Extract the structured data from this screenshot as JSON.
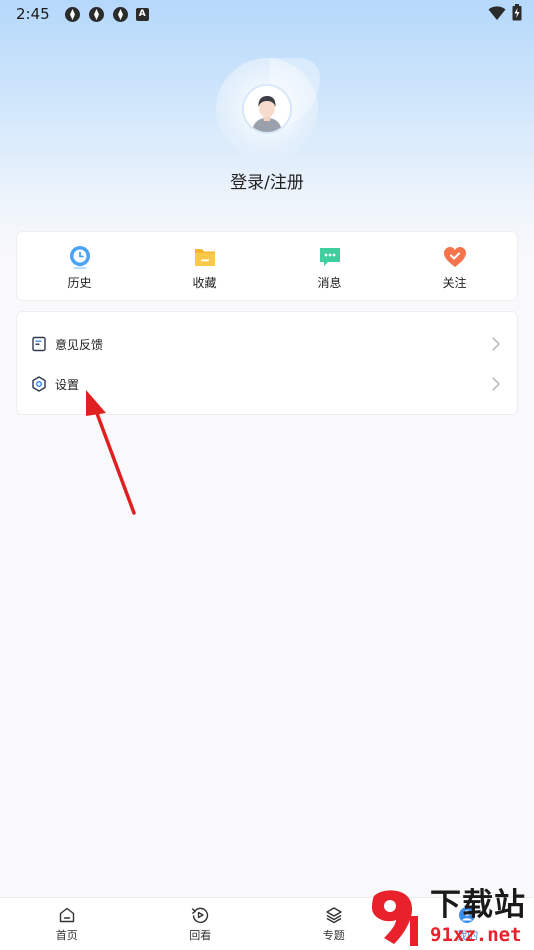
{
  "status_bar": {
    "time": "2:45",
    "notification_badge": "A"
  },
  "profile": {
    "login_label": "登录/注册"
  },
  "quick_actions": [
    {
      "label": "历史",
      "icon": "history-clock-icon",
      "color": "#4aa3f5"
    },
    {
      "label": "收藏",
      "icon": "favorite-folder-icon",
      "color": "#f8b52c"
    },
    {
      "label": "消息",
      "icon": "message-bubble-icon",
      "color": "#3fcf9e"
    },
    {
      "label": "关注",
      "icon": "follow-heart-icon",
      "color": "#f5734d"
    }
  ],
  "menu": [
    {
      "label": "意见反馈",
      "icon": "feedback-doc-icon"
    },
    {
      "label": "设置",
      "icon": "settings-gear-icon"
    }
  ],
  "tabbar": [
    {
      "label": "首页",
      "icon": "home-icon"
    },
    {
      "label": "回看",
      "icon": "replay-icon"
    },
    {
      "label": "专题",
      "icon": "layers-icon"
    },
    {
      "label": "我的",
      "icon": "profile-icon"
    }
  ],
  "watermark": {
    "text_top": "下载站",
    "text_bottom": "91xz.net",
    "logo_text": "9"
  },
  "colors": {
    "accent": "#3b8ff0",
    "arrow": "#e02020",
    "watermark_red": "#e8212a"
  }
}
